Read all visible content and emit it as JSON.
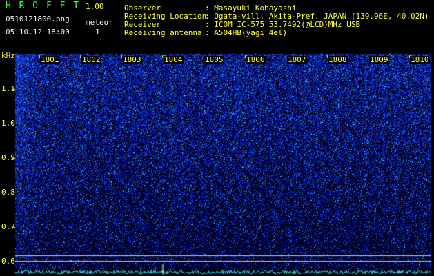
{
  "app": {
    "title": "H R O F F T",
    "version": "1.00"
  },
  "file": {
    "name": "0510121800.png",
    "datetime": "05.10.12 18:00"
  },
  "counter": {
    "label": "meteor",
    "value": "1"
  },
  "info": [
    {
      "label": "Observer",
      "value": ": Masayuki Kobayashi"
    },
    {
      "label": "Receiving Location",
      "value": ": Ogata-vill. Akita-Pref. JAPAN (139.96E, 40.02N)"
    },
    {
      "label": "Receiver",
      "value": ": ICOM IC-575 53.7492(@LCD)MHz USB"
    },
    {
      "label": "Receiving antenna",
      "value": ": A504HB(yagi 4el)"
    }
  ],
  "spectrogram": {
    "y_unit": "kHz",
    "y_ticks": [
      "1.1",
      "1.0",
      "0.9",
      "0.8",
      "0.7",
      "0.6"
    ],
    "time_labels": [
      "1801",
      "1802",
      "1803",
      "1804",
      "1805",
      "1806",
      "1807",
      "1808",
      "1809",
      "1810"
    ],
    "colors": {
      "background": "#000000",
      "noise": "#1f3fd0",
      "trace": "#30e0ff",
      "label": "#ffff40"
    }
  }
}
